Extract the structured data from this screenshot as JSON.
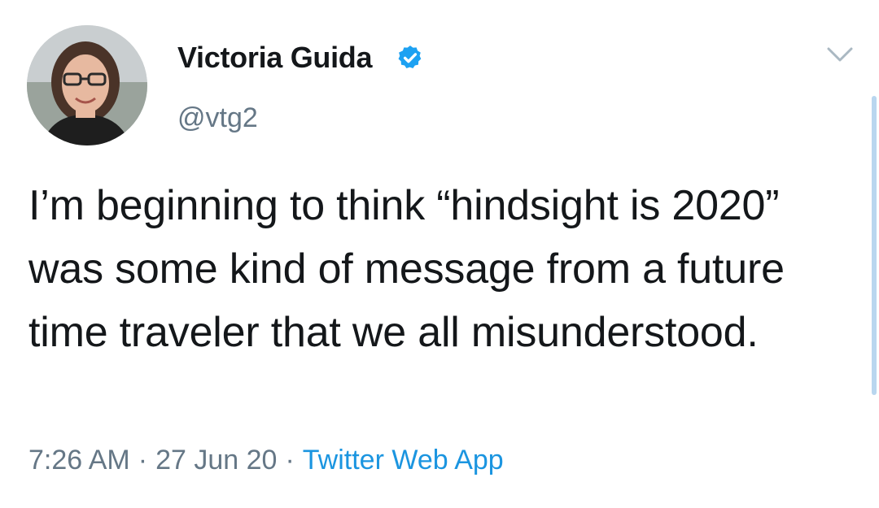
{
  "tweet": {
    "author": {
      "display_name": "Victoria Guida",
      "handle": "@vtg2",
      "verified": true,
      "avatar_icon": "user-avatar-photo"
    },
    "text": "I’m beginning to think “hindsight is 2020” was some kind of message from a future time traveler that we all misunderstood.",
    "time": "7:26 AM",
    "date": "27 Jun 20",
    "separator": "·",
    "source": "Twitter Web App",
    "menu_icon": "chevron-down-icon"
  },
  "colors": {
    "text": "#14171a",
    "muted": "#657786",
    "link": "#1b95e0",
    "verified_badge": "#1da1f2"
  }
}
